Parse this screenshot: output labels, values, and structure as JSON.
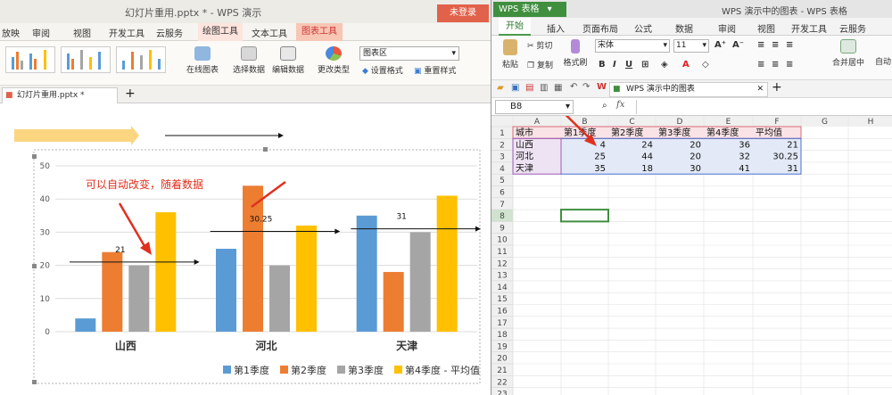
{
  "left_window": {
    "title": "幻灯片重用.pptx * - WPS 演示",
    "login": "未登录",
    "tabs": [
      "放映",
      "审阅",
      "视图",
      "开发工具",
      "云服务",
      "绘图工具",
      "文本工具",
      "图表工具"
    ],
    "ribbon": {
      "online_chart": "在线图表",
      "select_data": "选择数据",
      "edit_data": "编辑数据",
      "change_type": "更改类型",
      "chart_area": "图表区",
      "format": "设置格式",
      "reset_style": "重置样式"
    },
    "doc_tab": "幻灯片重用.pptx *",
    "add_tab": "+"
  },
  "right_window": {
    "app_button": "WPS 表格",
    "title": "WPS 演示中的图表 - WPS 表格",
    "tabs": [
      "开始",
      "插入",
      "页面布局",
      "公式",
      "数据",
      "审阅",
      "视图",
      "开发工具",
      "云服务"
    ],
    "ribbon": {
      "cut": "剪切",
      "copy": "复制",
      "paste": "粘贴",
      "format_painter": "格式刷",
      "font": "宋体",
      "size": "11",
      "merge_center": "合并居中",
      "auto": "自动"
    },
    "file_tab": "WPS 演示中的图表",
    "name_box": "B8",
    "fx": "fx",
    "columns": [
      "A",
      "B",
      "C",
      "D",
      "E",
      "F",
      "G",
      "H"
    ],
    "rows": [
      "1",
      "2",
      "3",
      "4",
      "5",
      "6",
      "7",
      "8",
      "9",
      "10",
      "11",
      "12",
      "13",
      "14",
      "15",
      "16",
      "17",
      "18",
      "19",
      "20",
      "21",
      "22",
      "23"
    ],
    "header": [
      "城市",
      "第1季度",
      "第2季度",
      "第3季度",
      "第4季度",
      "平均值"
    ],
    "data": [
      [
        "山西",
        "4",
        "24",
        "20",
        "36",
        "21"
      ],
      [
        "河北",
        "25",
        "44",
        "20",
        "32",
        "30.25"
      ],
      [
        "天津",
        "35",
        "18",
        "30",
        "41",
        "31"
      ]
    ]
  },
  "annotation": "可以自动改变，随着数据",
  "colors": {
    "q1": "#5b9bd5",
    "q2": "#ed7d31",
    "q3": "#a5a5a5",
    "q4": "#ffc000",
    "accent": "#e2614a",
    "green": "#3f8f3f"
  },
  "chart_data": {
    "type": "bar",
    "categories": [
      "山西",
      "河北",
      "天津"
    ],
    "series": [
      {
        "name": "第1季度",
        "values": [
          4,
          25,
          35
        ]
      },
      {
        "name": "第2季度",
        "values": [
          24,
          44,
          18
        ]
      },
      {
        "name": "第3季度",
        "values": [
          20,
          20,
          30
        ]
      },
      {
        "name": "第4季度 - 平均值",
        "values": [
          36,
          32,
          41
        ]
      }
    ],
    "averages": [
      21,
      30.25,
      31
    ],
    "average_labels": [
      "21",
      "30.25",
      "31"
    ],
    "yticks": [
      "0",
      "10",
      "20",
      "30",
      "40",
      "50"
    ],
    "ylim": [
      0,
      50
    ],
    "grid": true,
    "legend_position": "bottom"
  }
}
